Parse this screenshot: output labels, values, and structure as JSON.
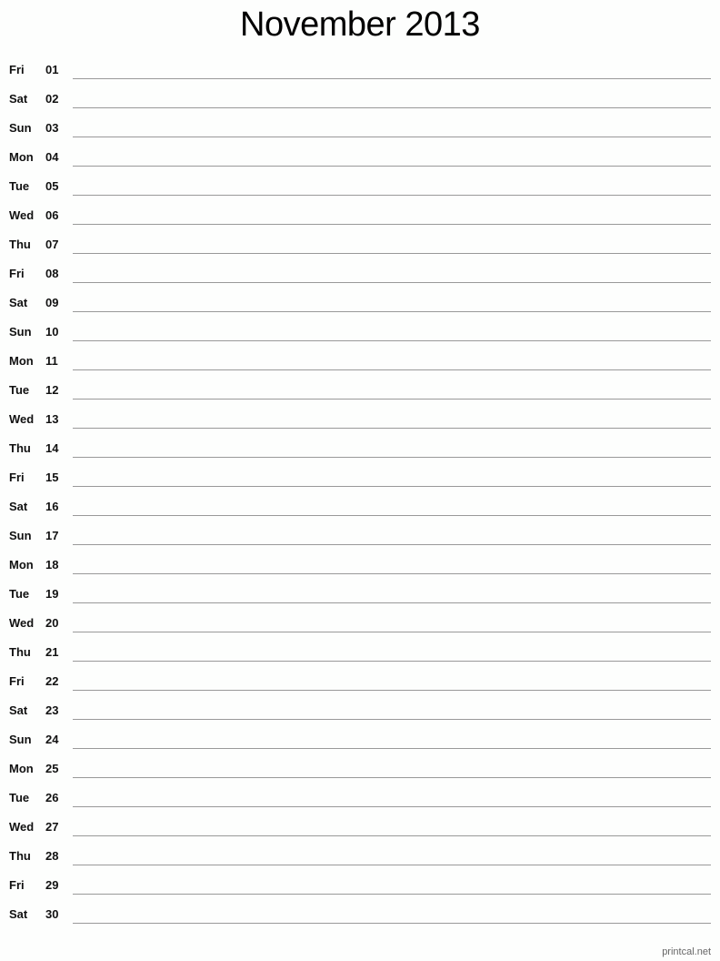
{
  "title": "November 2013",
  "days": [
    {
      "dow": "Fri",
      "day": "01"
    },
    {
      "dow": "Sat",
      "day": "02"
    },
    {
      "dow": "Sun",
      "day": "03"
    },
    {
      "dow": "Mon",
      "day": "04"
    },
    {
      "dow": "Tue",
      "day": "05"
    },
    {
      "dow": "Wed",
      "day": "06"
    },
    {
      "dow": "Thu",
      "day": "07"
    },
    {
      "dow": "Fri",
      "day": "08"
    },
    {
      "dow": "Sat",
      "day": "09"
    },
    {
      "dow": "Sun",
      "day": "10"
    },
    {
      "dow": "Mon",
      "day": "11"
    },
    {
      "dow": "Tue",
      "day": "12"
    },
    {
      "dow": "Wed",
      "day": "13"
    },
    {
      "dow": "Thu",
      "day": "14"
    },
    {
      "dow": "Fri",
      "day": "15"
    },
    {
      "dow": "Sat",
      "day": "16"
    },
    {
      "dow": "Sun",
      "day": "17"
    },
    {
      "dow": "Mon",
      "day": "18"
    },
    {
      "dow": "Tue",
      "day": "19"
    },
    {
      "dow": "Wed",
      "day": "20"
    },
    {
      "dow": "Thu",
      "day": "21"
    },
    {
      "dow": "Fri",
      "day": "22"
    },
    {
      "dow": "Sat",
      "day": "23"
    },
    {
      "dow": "Sun",
      "day": "24"
    },
    {
      "dow": "Mon",
      "day": "25"
    },
    {
      "dow": "Tue",
      "day": "26"
    },
    {
      "dow": "Wed",
      "day": "27"
    },
    {
      "dow": "Thu",
      "day": "28"
    },
    {
      "dow": "Fri",
      "day": "29"
    },
    {
      "dow": "Sat",
      "day": "30"
    }
  ],
  "footer": "printcal.net"
}
